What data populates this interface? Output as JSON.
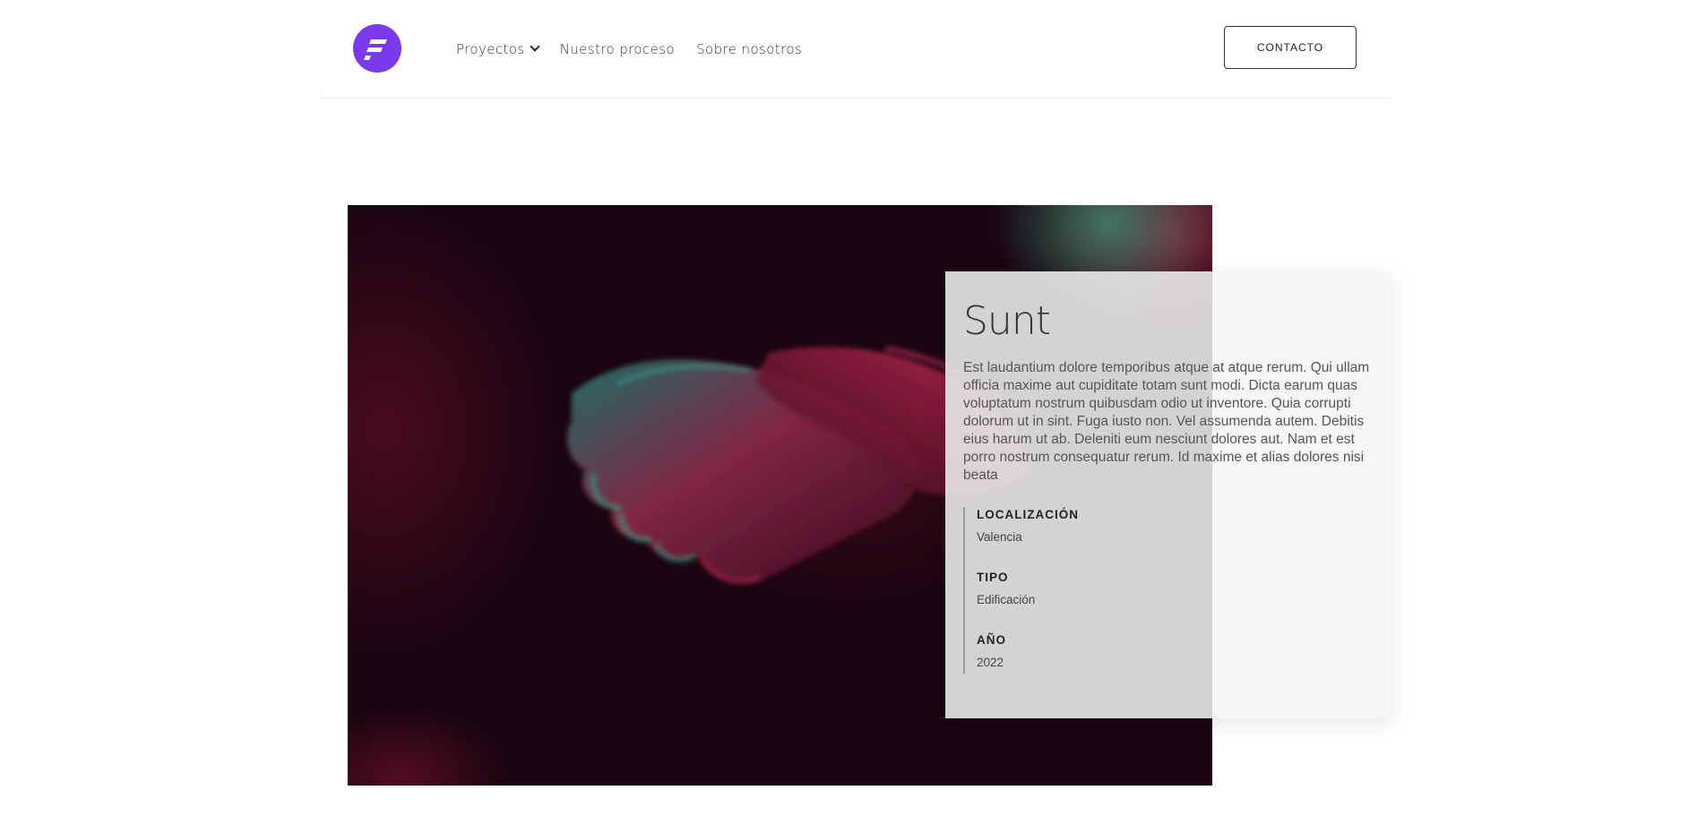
{
  "header": {
    "logo_icon": "f-letter-logo-icon",
    "logo_color": "#7c3aed",
    "nav": [
      {
        "label": "Proyectos",
        "has_dropdown": true
      },
      {
        "label": "Nuestro proceso",
        "has_dropdown": false
      },
      {
        "label": "Sobre nosotros",
        "has_dropdown": false
      }
    ],
    "contact_label": "CONTACTO"
  },
  "project": {
    "title": "Sunt",
    "description": "Est laudantium dolore temporibus atque at atque rerum. Qui ullam officia maxime aut cupiditate totam sunt modi. Dicta earum quas voluptatum nostrum quibusdam odio ut inventore. Quia corrupti dolorum ut in sint. Fuga iusto non. Vel assumenda autem. Debitis eius harum ut ab. Deleniti eum nesciunt dolores aut. Nam et est porro nostrum consequatur rerum. Id maxime et alias dolores nisi beata",
    "facts": [
      {
        "label": "LOCALIZACIÓN",
        "value": "Valencia"
      },
      {
        "label": "TIPO",
        "value": "Edificación"
      },
      {
        "label": "AÑO",
        "value": "2022"
      }
    ],
    "image": "hands-photo-image"
  }
}
